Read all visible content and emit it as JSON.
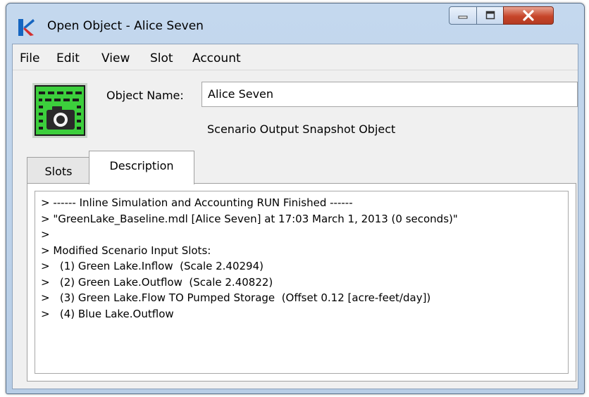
{
  "window": {
    "title": "Open Object - Alice Seven",
    "controls": {
      "minimize_icon": "minimize-icon",
      "maximize_icon": "maximize-icon",
      "close_icon": "close-icon"
    }
  },
  "menubar": {
    "items": [
      "File",
      "Edit",
      "View",
      "Slot",
      "Account"
    ]
  },
  "object": {
    "name_label": "Object Name:",
    "name_value": "Alice Seven",
    "type_label": "Scenario Output Snapshot Object",
    "icon": "snapshot-camera-icon"
  },
  "tabs": [
    {
      "label": "Slots",
      "selected": false
    },
    {
      "label": "Description",
      "selected": true
    }
  ],
  "description": {
    "lines": [
      "> ------ Inline Simulation and Accounting RUN Finished ------",
      "> \"GreenLake_Baseline.mdl [Alice Seven] at 17:03 March 1, 2013 (0 seconds)\"",
      ">",
      "> Modified Scenario Input Slots:",
      ">   (1) Green Lake.Inflow  (Scale 2.40294)",
      ">   (2) Green Lake.Outflow  (Scale 2.40822)",
      ">   (3) Green Lake.Flow TO Pumped Storage  (Offset 0.12 [acre-feet/day])",
      ">   (4) Blue Lake.Outflow"
    ]
  },
  "colors": {
    "titlebar": "#c4d8ee",
    "close_button": "#c7462a",
    "icon_green": "#3ccf3c",
    "app_icon_blue": "#1565c0",
    "app_icon_red": "#d32f2f"
  }
}
